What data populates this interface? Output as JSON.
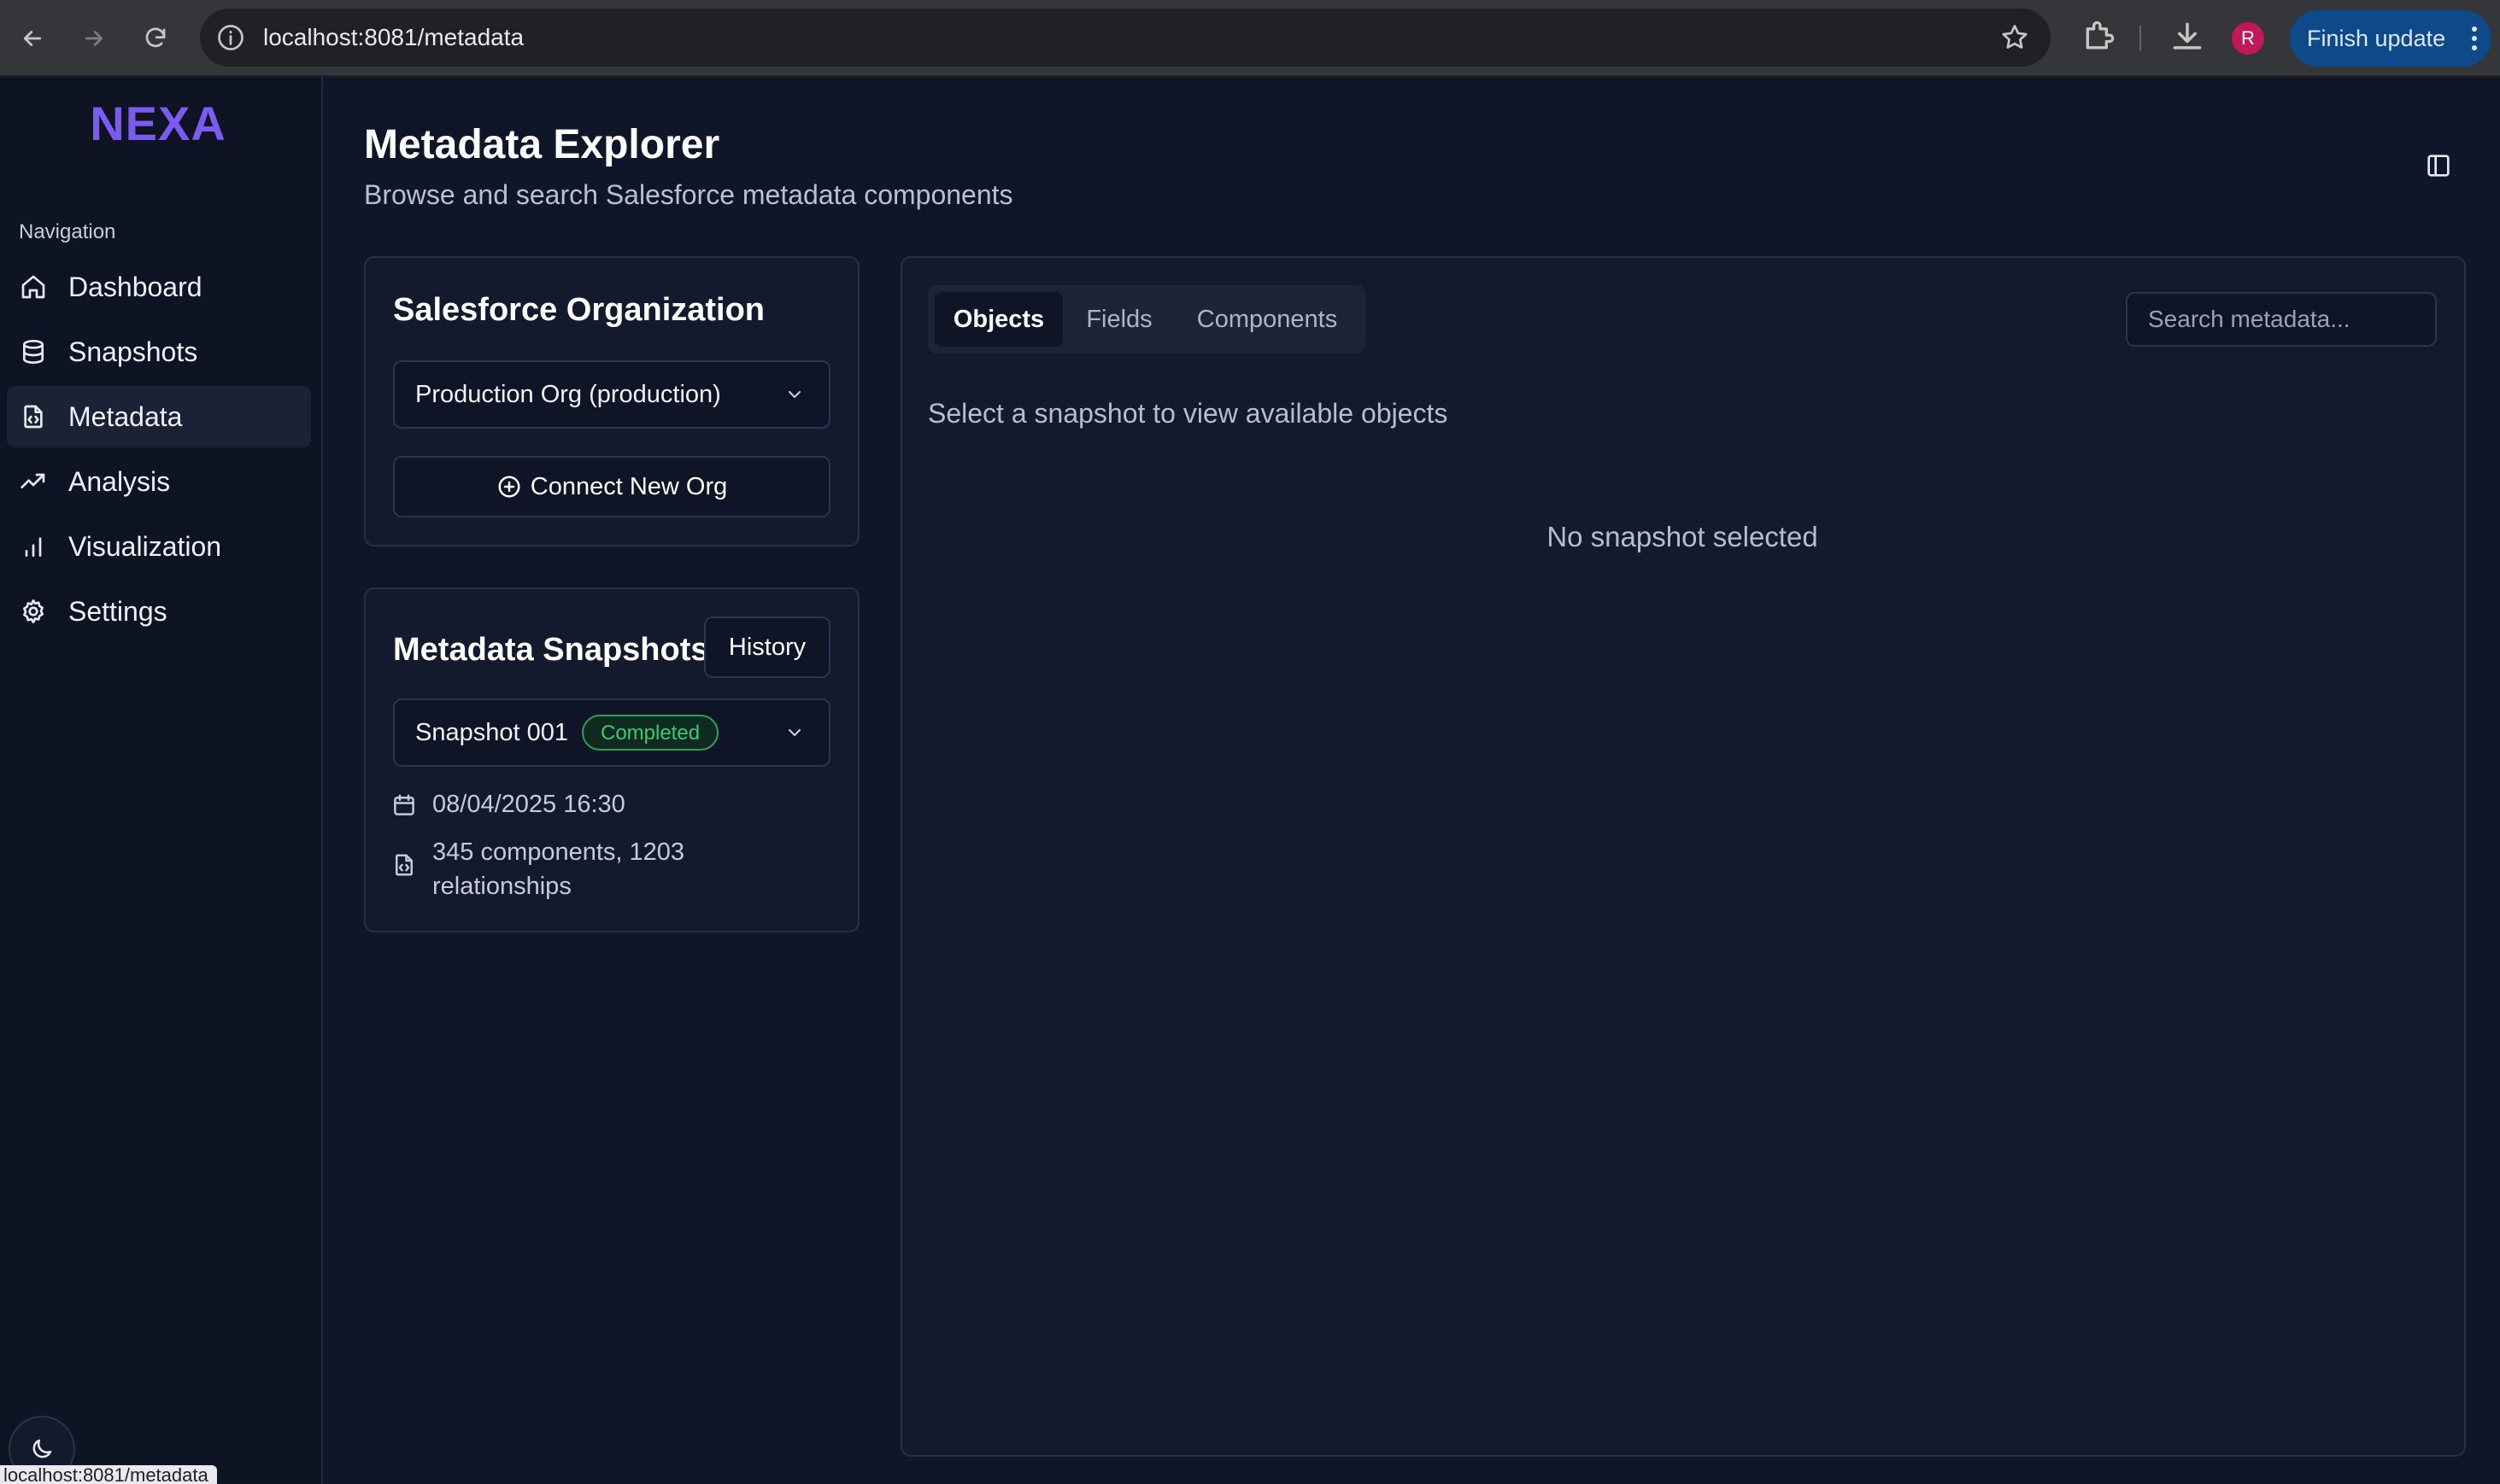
{
  "browser": {
    "url": "localhost:8081/metadata",
    "profile_initial": "R",
    "finish_update_label": "Finish update"
  },
  "sidebar": {
    "logo": "NEXA",
    "nav_heading": "Navigation",
    "items": [
      {
        "label": "Dashboard",
        "icon": "home-icon",
        "active": false
      },
      {
        "label": "Snapshots",
        "icon": "database-icon",
        "active": false
      },
      {
        "label": "Metadata",
        "icon": "file-code-icon",
        "active": true
      },
      {
        "label": "Analysis",
        "icon": "trending-up-icon",
        "active": false
      },
      {
        "label": "Visualization",
        "icon": "bar-chart-icon",
        "active": false
      },
      {
        "label": "Settings",
        "icon": "gear-icon",
        "active": false
      }
    ],
    "theme_toggle_icon": "moon-icon"
  },
  "status_bar_url": "localhost:8081/metadata",
  "header": {
    "title": "Metadata Explorer",
    "subtitle": "Browse and search Salesforce metadata components"
  },
  "org_card": {
    "title": "Salesforce Organization",
    "selected_org": "Production Org (production)",
    "connect_label": "Connect New Org"
  },
  "snapshots_card": {
    "title": "Metadata Snapshots",
    "history_label": "History",
    "selected_snapshot": "Snapshot 001",
    "status_badge": "Completed",
    "date": "08/04/2025 16:30",
    "summary": "345 components, 1203 relationships"
  },
  "explorer": {
    "tabs": [
      {
        "label": "Objects",
        "active": true
      },
      {
        "label": "Fields",
        "active": false
      },
      {
        "label": "Components",
        "active": false
      }
    ],
    "search_placeholder": "Search metadata...",
    "helper_text": "Select a snapshot to view available objects",
    "empty_text": "No snapshot selected"
  },
  "colors": {
    "background": "#0f1629",
    "brand": "#7c5cf0",
    "success": "#3ccb6e"
  }
}
